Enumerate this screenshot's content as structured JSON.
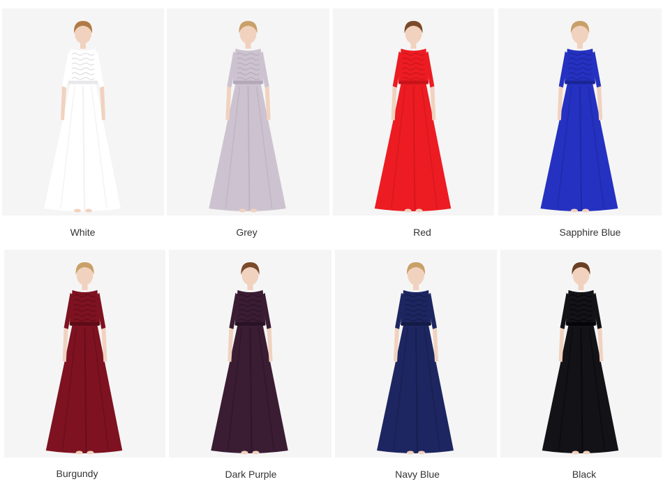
{
  "swatches": [
    {
      "label": "White",
      "dress_color": "#ffffff",
      "dress_shade": "#e8e8ea",
      "hair_color": "#b07a45",
      "image_name": "white-dress-photo"
    },
    {
      "label": "Grey",
      "dress_color": "#cdc3d0",
      "dress_shade": "#b3a8b8",
      "hair_color": "#c8a068",
      "image_name": "grey-dress-photo"
    },
    {
      "label": "Red",
      "dress_color": "#ec1c22",
      "dress_shade": "#c8121a",
      "hair_color": "#7a4a2a",
      "image_name": "red-dress-photo"
    },
    {
      "label": "Sapphire Blue",
      "dress_color": "#2531c0",
      "dress_shade": "#1a2596",
      "hair_color": "#c8a068",
      "image_name": "sapphire-blue-dress-photo"
    },
    {
      "label": "Burgundy",
      "dress_color": "#7e1220",
      "dress_shade": "#5c0c16",
      "hair_color": "#c8a068",
      "image_name": "burgundy-dress-photo"
    },
    {
      "label": "Dark Purple",
      "dress_color": "#3a1c33",
      "dress_shade": "#271224",
      "hair_color": "#7a4a2a",
      "image_name": "dark-purple-dress-photo"
    },
    {
      "label": "Navy Blue",
      "dress_color": "#1d2660",
      "dress_shade": "#131a44",
      "hair_color": "#c8a068",
      "image_name": "navy-blue-dress-photo"
    },
    {
      "label": "Black",
      "dress_color": "#121217",
      "dress_shade": "#050508",
      "hair_color": "#6a3f24",
      "image_name": "black-dress-photo"
    }
  ]
}
